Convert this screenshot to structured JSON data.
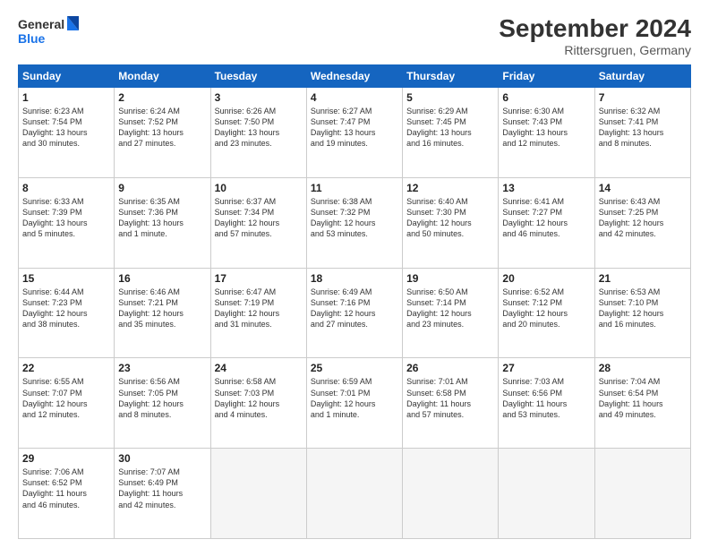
{
  "header": {
    "logo_line1": "General",
    "logo_line2": "Blue",
    "title": "September 2024",
    "subtitle": "Rittersgruen, Germany"
  },
  "days_of_week": [
    "Sunday",
    "Monday",
    "Tuesday",
    "Wednesday",
    "Thursday",
    "Friday",
    "Saturday"
  ],
  "weeks": [
    [
      {
        "day": "1",
        "info": "Sunrise: 6:23 AM\nSunset: 7:54 PM\nDaylight: 13 hours\nand 30 minutes."
      },
      {
        "day": "2",
        "info": "Sunrise: 6:24 AM\nSunset: 7:52 PM\nDaylight: 13 hours\nand 27 minutes."
      },
      {
        "day": "3",
        "info": "Sunrise: 6:26 AM\nSunset: 7:50 PM\nDaylight: 13 hours\nand 23 minutes."
      },
      {
        "day": "4",
        "info": "Sunrise: 6:27 AM\nSunset: 7:47 PM\nDaylight: 13 hours\nand 19 minutes."
      },
      {
        "day": "5",
        "info": "Sunrise: 6:29 AM\nSunset: 7:45 PM\nDaylight: 13 hours\nand 16 minutes."
      },
      {
        "day": "6",
        "info": "Sunrise: 6:30 AM\nSunset: 7:43 PM\nDaylight: 13 hours\nand 12 minutes."
      },
      {
        "day": "7",
        "info": "Sunrise: 6:32 AM\nSunset: 7:41 PM\nDaylight: 13 hours\nand 8 minutes."
      }
    ],
    [
      {
        "day": "8",
        "info": "Sunrise: 6:33 AM\nSunset: 7:39 PM\nDaylight: 13 hours\nand 5 minutes."
      },
      {
        "day": "9",
        "info": "Sunrise: 6:35 AM\nSunset: 7:36 PM\nDaylight: 13 hours\nand 1 minute."
      },
      {
        "day": "10",
        "info": "Sunrise: 6:37 AM\nSunset: 7:34 PM\nDaylight: 12 hours\nand 57 minutes."
      },
      {
        "day": "11",
        "info": "Sunrise: 6:38 AM\nSunset: 7:32 PM\nDaylight: 12 hours\nand 53 minutes."
      },
      {
        "day": "12",
        "info": "Sunrise: 6:40 AM\nSunset: 7:30 PM\nDaylight: 12 hours\nand 50 minutes."
      },
      {
        "day": "13",
        "info": "Sunrise: 6:41 AM\nSunset: 7:27 PM\nDaylight: 12 hours\nand 46 minutes."
      },
      {
        "day": "14",
        "info": "Sunrise: 6:43 AM\nSunset: 7:25 PM\nDaylight: 12 hours\nand 42 minutes."
      }
    ],
    [
      {
        "day": "15",
        "info": "Sunrise: 6:44 AM\nSunset: 7:23 PM\nDaylight: 12 hours\nand 38 minutes."
      },
      {
        "day": "16",
        "info": "Sunrise: 6:46 AM\nSunset: 7:21 PM\nDaylight: 12 hours\nand 35 minutes."
      },
      {
        "day": "17",
        "info": "Sunrise: 6:47 AM\nSunset: 7:19 PM\nDaylight: 12 hours\nand 31 minutes."
      },
      {
        "day": "18",
        "info": "Sunrise: 6:49 AM\nSunset: 7:16 PM\nDaylight: 12 hours\nand 27 minutes."
      },
      {
        "day": "19",
        "info": "Sunrise: 6:50 AM\nSunset: 7:14 PM\nDaylight: 12 hours\nand 23 minutes."
      },
      {
        "day": "20",
        "info": "Sunrise: 6:52 AM\nSunset: 7:12 PM\nDaylight: 12 hours\nand 20 minutes."
      },
      {
        "day": "21",
        "info": "Sunrise: 6:53 AM\nSunset: 7:10 PM\nDaylight: 12 hours\nand 16 minutes."
      }
    ],
    [
      {
        "day": "22",
        "info": "Sunrise: 6:55 AM\nSunset: 7:07 PM\nDaylight: 12 hours\nand 12 minutes."
      },
      {
        "day": "23",
        "info": "Sunrise: 6:56 AM\nSunset: 7:05 PM\nDaylight: 12 hours\nand 8 minutes."
      },
      {
        "day": "24",
        "info": "Sunrise: 6:58 AM\nSunset: 7:03 PM\nDaylight: 12 hours\nand 4 minutes."
      },
      {
        "day": "25",
        "info": "Sunrise: 6:59 AM\nSunset: 7:01 PM\nDaylight: 12 hours\nand 1 minute."
      },
      {
        "day": "26",
        "info": "Sunrise: 7:01 AM\nSunset: 6:58 PM\nDaylight: 11 hours\nand 57 minutes."
      },
      {
        "day": "27",
        "info": "Sunrise: 7:03 AM\nSunset: 6:56 PM\nDaylight: 11 hours\nand 53 minutes."
      },
      {
        "day": "28",
        "info": "Sunrise: 7:04 AM\nSunset: 6:54 PM\nDaylight: 11 hours\nand 49 minutes."
      }
    ],
    [
      {
        "day": "29",
        "info": "Sunrise: 7:06 AM\nSunset: 6:52 PM\nDaylight: 11 hours\nand 46 minutes."
      },
      {
        "day": "30",
        "info": "Sunrise: 7:07 AM\nSunset: 6:49 PM\nDaylight: 11 hours\nand 42 minutes."
      },
      {
        "day": "",
        "info": ""
      },
      {
        "day": "",
        "info": ""
      },
      {
        "day": "",
        "info": ""
      },
      {
        "day": "",
        "info": ""
      },
      {
        "day": "",
        "info": ""
      }
    ]
  ]
}
